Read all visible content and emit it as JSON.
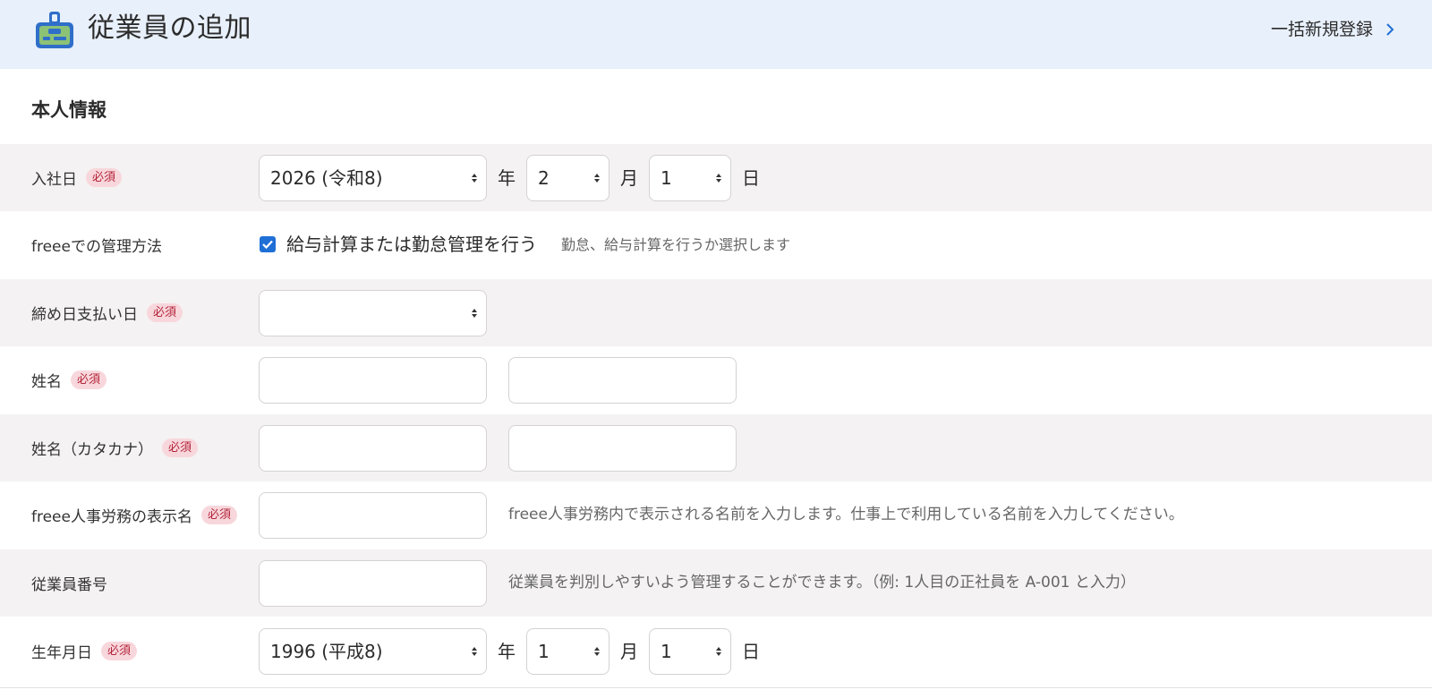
{
  "header": {
    "title": "従業員の追加",
    "bulk_link_label": "一括新規登録",
    "icon": "employee-badge-icon",
    "background": "#e8f0fb"
  },
  "section_title": "本人情報",
  "required_label": "必須",
  "form": {
    "hire_date": {
      "label": "入社日",
      "year": "2026 (令和8)",
      "year_unit": "年",
      "month": "2",
      "month_unit": "月",
      "day": "1",
      "day_unit": "日"
    },
    "management": {
      "label": "freeeでの管理方法",
      "checkbox_label": "給与計算または勤怠管理を行う",
      "checked": true,
      "hint": "勤怠、給与計算を行うか選択します"
    },
    "closing_payday": {
      "label": "締め日支払い日",
      "value": ""
    },
    "name": {
      "label": "姓名",
      "last": "",
      "first": ""
    },
    "name_kana": {
      "label": "姓名（カタカナ）",
      "last": "",
      "first": ""
    },
    "display_name": {
      "label": "freee人事労務の表示名",
      "value": "",
      "hint": "freee人事労務内で表示される名前を入力します。仕事上で利用している名前を入力してください。"
    },
    "employee_number": {
      "label": "従業員番号",
      "value": "",
      "hint": "従業員を判別しやすいよう管理することができます。（例: 1人目の正社員を A-001 と入力）"
    },
    "birth_date": {
      "label": "生年月日",
      "year": "1996 (平成8)",
      "year_unit": "年",
      "month": "1",
      "month_unit": "月",
      "day": "1",
      "day_unit": "日"
    }
  },
  "colors": {
    "accent": "#1f6fd6",
    "required_text": "#b3243a",
    "required_bg": "#f8d7dc",
    "row_shade": "#f4f2f2"
  }
}
